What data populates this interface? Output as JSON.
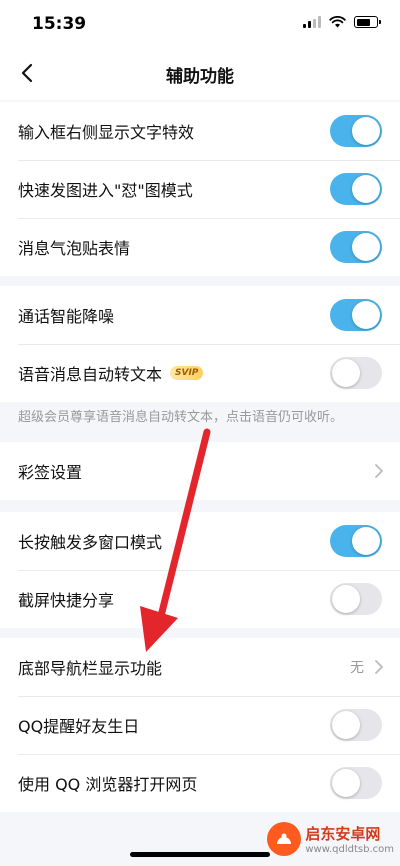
{
  "status_bar": {
    "time": "15:39",
    "battery_level": 0.7
  },
  "nav": {
    "title": "辅助功能"
  },
  "group1": [
    {
      "label": "输入框右侧显示文字特效",
      "on": true
    },
    {
      "label": "快速发图进入\"怼\"图模式",
      "on": true
    },
    {
      "label": "消息气泡贴表情",
      "on": true
    }
  ],
  "group2": [
    {
      "label": "通话智能降噪",
      "on": true
    },
    {
      "label": "语音消息自动转文本",
      "badge": "SVIP",
      "on": false
    }
  ],
  "group2_hint": "超级会员尊享语音消息自动转文本，点击语音仍可收听。",
  "group3": [
    {
      "label": "彩签设置"
    }
  ],
  "group4": [
    {
      "label": "长按触发多窗口模式",
      "on": true
    },
    {
      "label": "截屏快捷分享",
      "on": false
    }
  ],
  "group5": [
    {
      "label": "底部导航栏显示功能",
      "value": "无"
    },
    {
      "label": "QQ提醒好友生日",
      "on": false
    },
    {
      "label": "使用 QQ 浏览器打开网页",
      "on": false
    }
  ],
  "watermark": {
    "name": "启东安卓网",
    "url": "www.qdldtsb.com"
  },
  "colors": {
    "toggle_on": "#4ab3ec",
    "toggle_off": "#e5e5ea",
    "annotation_arrow": "#e3262b"
  }
}
